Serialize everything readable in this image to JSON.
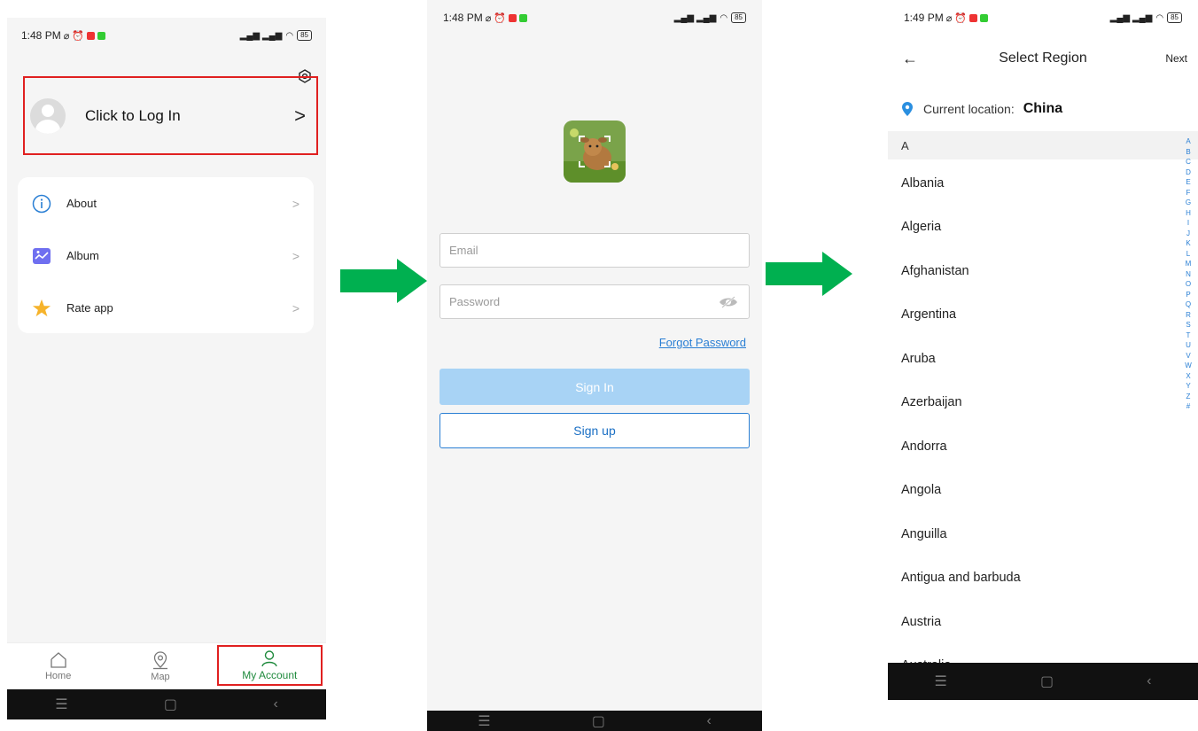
{
  "screen1": {
    "status": {
      "time": "1:48 PM",
      "battery": "85"
    },
    "login": {
      "label": "Click to Log In",
      "chevron": ">"
    },
    "menu": [
      {
        "label": "About",
        "icon": "info-icon"
      },
      {
        "label": "Album",
        "icon": "album-icon"
      },
      {
        "label": "Rate app",
        "icon": "star-icon"
      }
    ],
    "menu_chevron": ">",
    "tabs": [
      {
        "label": "Home",
        "icon": "home-icon"
      },
      {
        "label": "Map",
        "icon": "map-pin-icon"
      },
      {
        "label": "My Account",
        "icon": "user-icon",
        "active": true
      }
    ]
  },
  "screen2": {
    "status": {
      "time": "1:48 PM",
      "battery": "85"
    },
    "email_placeholder": "Email",
    "password_placeholder": "Password",
    "forgot_label": "Forgot Password",
    "signin_label": "Sign In",
    "signup_label": "Sign up"
  },
  "screen3": {
    "status": {
      "time": "1:49 PM",
      "battery": "85"
    },
    "title": "Select Region",
    "back_glyph": "←",
    "next_label": "Next",
    "current_label": "Current location:",
    "current_value": "China",
    "section_header": "A",
    "countries": [
      "Albania",
      "Algeria",
      "Afghanistan",
      "Argentina",
      "Aruba",
      "Azerbaijan",
      "Andorra",
      "Angola",
      "Anguilla",
      "Antigua and barbuda",
      "Austria",
      "Australia"
    ],
    "index_letters": [
      "A",
      "B",
      "C",
      "D",
      "E",
      "F",
      "G",
      "H",
      "I",
      "J",
      "K",
      "L",
      "M",
      "N",
      "O",
      "P",
      "Q",
      "R",
      "S",
      "T",
      "U",
      "V",
      "W",
      "X",
      "Y",
      "Z",
      "#"
    ]
  },
  "colors": {
    "arrow": "#00b050",
    "highlight": "#e02020",
    "active_tab": "#1f8a3d",
    "link": "#2a7fd4",
    "signin_disabled": "#a8d3f5"
  },
  "navbar_glyphs": {
    "menu": "☰",
    "home": "▢",
    "back": "‹"
  }
}
